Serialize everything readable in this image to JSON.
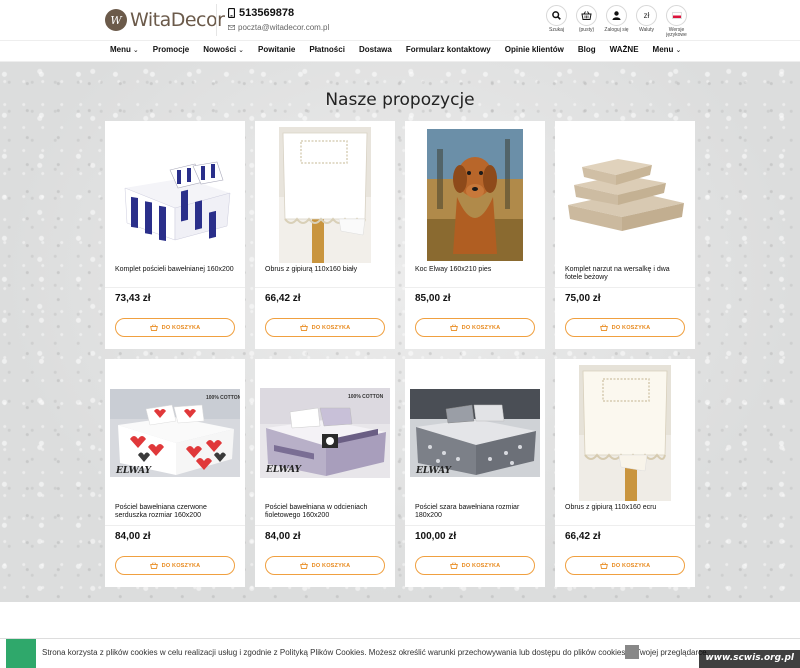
{
  "header": {
    "logo_text": "WitaDecor",
    "phone": "513569878",
    "email": "poczta@witadecor.com.pl",
    "icons": [
      {
        "label": "Szukaj",
        "icon": "search-icon"
      },
      {
        "label": "(pusty)",
        "icon": "basket-icon"
      },
      {
        "label": "Zaloguj się",
        "icon": "user-icon"
      },
      {
        "label": "Waluty",
        "icon": "currency-icon",
        "glyph": "zł"
      },
      {
        "label": "Wersje językowe",
        "icon": "flag-pl-icon"
      }
    ]
  },
  "nav": {
    "items": [
      "Menu",
      "Promocje",
      "Nowości",
      "Powitanie",
      "Płatności",
      "Dostawa",
      "Formularz kontaktowy",
      "Opinie klientów",
      "Blog",
      "WAŻNE",
      "Menu"
    ]
  },
  "section": {
    "title": "Nasze propozycje"
  },
  "button_label": "DO KOSZYKA",
  "products": [
    {
      "name": "Komplet pościeli bawełnianej 160x200",
      "price": "73,43 zł"
    },
    {
      "name": "Obrus z gipiurą 110x160 biały",
      "price": "66,42 zł"
    },
    {
      "name": "Koc Elway 160x210 pies",
      "price": "85,00 zł"
    },
    {
      "name": "Komplet narzut na wersalkę i dwa fotele beżowy",
      "price": "75,00 zł"
    },
    {
      "name": "Pościel bawełniana czerwone serduszka rozmiar 160x200",
      "price": "84,00 zł"
    },
    {
      "name": "Pościel bawełniana w odcieniach fioletowego 160x200",
      "price": "84,00 zł"
    },
    {
      "name": "Pościel szara bawełniana rozmiar 180x200",
      "price": "100,00 zł"
    },
    {
      "name": "Obrus z gipiurą 110x160 ecru",
      "price": "66,42 zł"
    }
  ],
  "image_labels": {
    "cotton": "100% COTTON",
    "brand": "ELWAY"
  },
  "cookie": {
    "text": "Strona korzysta z plików cookies w celu realizacji usług i zgodnie z Polityką Plików Cookies. Możesz określić warunki przechowywania lub dostępu do plików cookies w Twojej przeglądarce."
  },
  "watermark": "www.scwis.org.pl",
  "colors": {
    "accent": "#e8891c",
    "cookie_green": "#2fa86b"
  }
}
